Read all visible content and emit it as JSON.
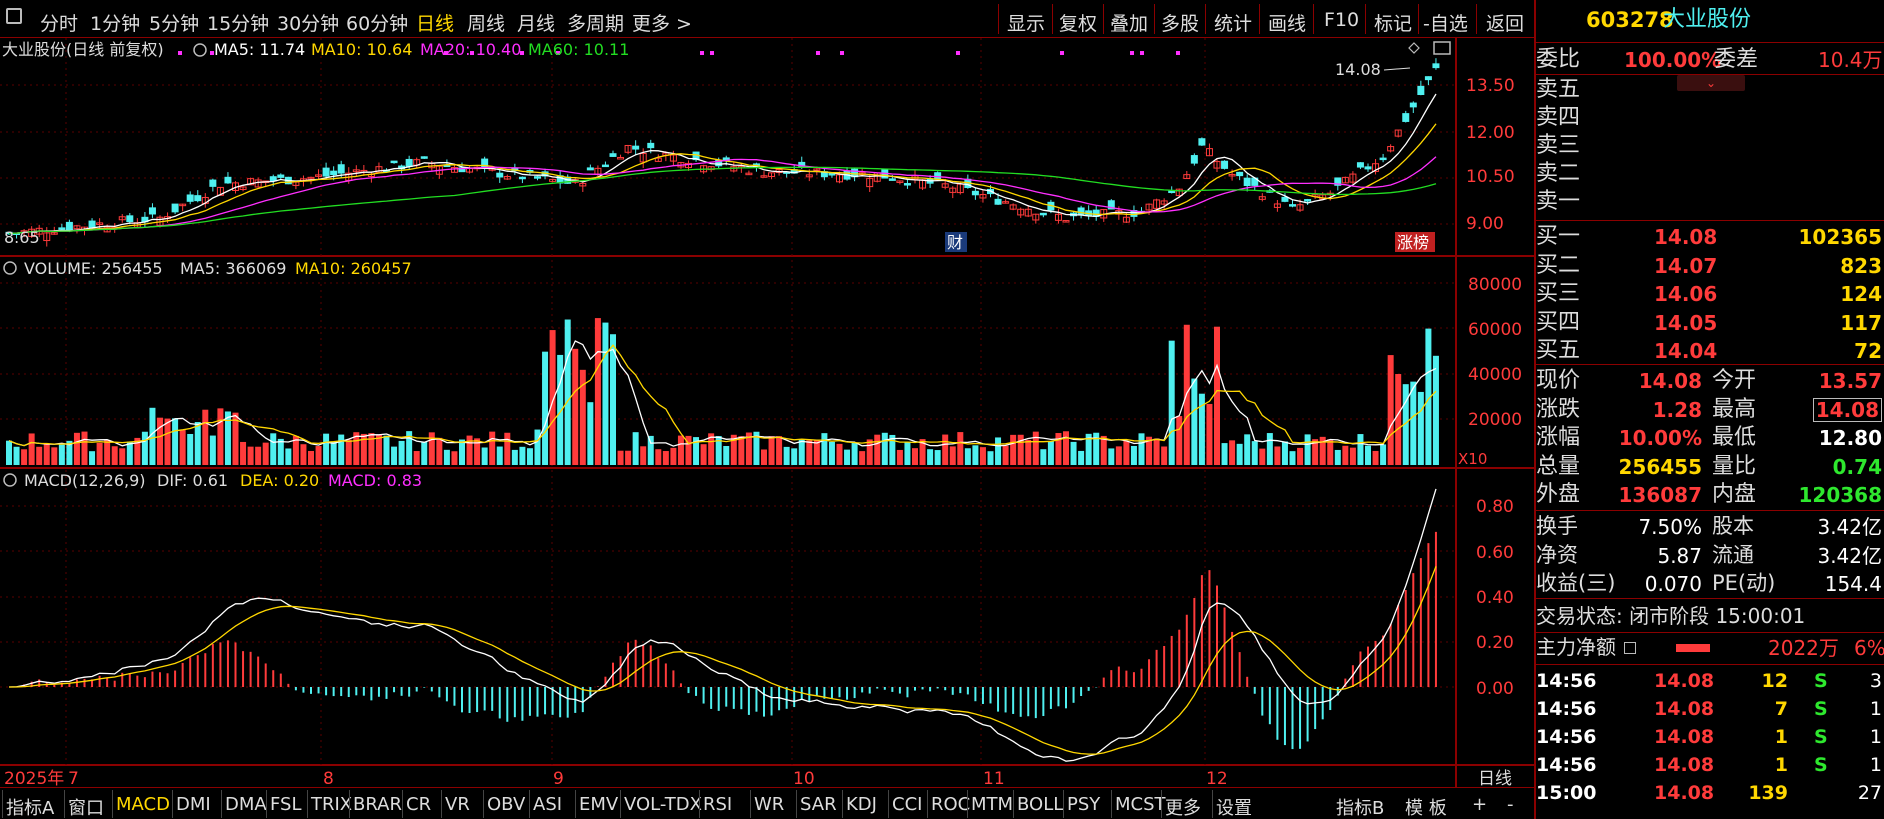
{
  "toolbar": {
    "left_items": [
      "分时",
      "1分钟",
      "5分钟",
      "15分钟",
      "30分钟",
      "60分钟",
      "日线",
      "周线",
      "月线",
      "多周期",
      "更多 >"
    ],
    "active": "日线",
    "right_items": [
      "显示",
      "复权",
      "叠加",
      "多股",
      "统计",
      "画线",
      "F10",
      "标记",
      "-自选",
      "返回"
    ]
  },
  "kline": {
    "title": "大业股份(日线 前复权)",
    "ma5_label": "MA5: 11.74",
    "ma10_label": "MA10: 10.64",
    "ma20_label": "MA20: 10.40",
    "ma60_label": "MA60: 10.11",
    "y_ticks": [
      "13.50",
      "12.00",
      "10.50",
      "9.00"
    ],
    "high_annotation": "14.08",
    "low_annotation": "8.65",
    "badge_cai": "财",
    "badge_zhangbang": "涨榜"
  },
  "volume": {
    "label": "VOLUME: 256455",
    "ma5_label": "MA5: 366069",
    "ma10_label": "MA10: 260457",
    "y_ticks": [
      "80000",
      "60000",
      "40000",
      "20000"
    ],
    "unit": "X10"
  },
  "macd": {
    "label": "MACD(12,26,9)",
    "dif_label": "DIF: 0.61",
    "dea_label": "DEA: 0.20",
    "macd_label": "MACD: 0.83",
    "y_ticks": [
      "0.80",
      "0.60",
      "0.40",
      "0.20",
      "0.00"
    ]
  },
  "date_axis": {
    "labels": [
      "2025年",
      "7",
      "8",
      "9",
      "10",
      "11",
      "12"
    ],
    "period": "日线"
  },
  "bottombar": {
    "items": [
      "指标A",
      "窗口",
      "MACD",
      "DMI",
      "DMA",
      "FSL",
      "TRIX",
      "BRAR",
      "CR",
      "VR",
      "OBV",
      "ASI",
      "EMV",
      "VOL-TDX",
      "RSI",
      "WR",
      "SAR",
      "KDJ",
      "CCI",
      "ROC",
      "MTM",
      "BOLL",
      "PSY",
      "MCST",
      "更多",
      "设置"
    ],
    "right_items": [
      "指标B",
      "模 板",
      "+",
      "-"
    ],
    "active": "MACD"
  },
  "quote": {
    "code": "603278",
    "name": "大业股份",
    "weibi_label": "委比",
    "weibi_value": "100.00%",
    "weicha_label": "委差",
    "weicha_value": "10.4万",
    "sell_labels": [
      "卖五",
      "卖四",
      "卖三",
      "卖二",
      "卖一"
    ],
    "buys": [
      {
        "label": "买一",
        "price": "14.08",
        "vol": "102365"
      },
      {
        "label": "买二",
        "price": "14.07",
        "vol": "823"
      },
      {
        "label": "买三",
        "price": "14.06",
        "vol": "124"
      },
      {
        "label": "买四",
        "price": "14.05",
        "vol": "117"
      },
      {
        "label": "买五",
        "price": "14.04",
        "vol": "72"
      }
    ],
    "stats": [
      {
        "l1": "现价",
        "v1": "14.08",
        "c1": "red",
        "l2": "今开",
        "v2": "13.57",
        "c2": "red"
      },
      {
        "l1": "涨跌",
        "v1": "1.28",
        "c1": "red",
        "l2": "最高",
        "v2": "14.08",
        "c2": "red"
      },
      {
        "l1": "涨幅",
        "v1": "10.00%",
        "c1": "red",
        "l2": "最低",
        "v2": "12.80",
        "c2": "wht"
      },
      {
        "l1": "总量",
        "v1": "256455",
        "c1": "yel",
        "l2": "量比",
        "v2": "0.74",
        "c2": "grn"
      },
      {
        "l1": "外盘",
        "v1": "136087",
        "c1": "red",
        "l2": "内盘",
        "v2": "120368",
        "c2": "grn"
      }
    ],
    "stats2": [
      {
        "l1": "换手",
        "v1": "7.50%",
        "l2": "股本",
        "v2": "3.42亿"
      },
      {
        "l1": "净资",
        "v1": "5.87",
        "l2": "流通",
        "v2": "3.42亿"
      },
      {
        "l1": "收益(三)",
        "v1": "0.070",
        "l2": "PE(动)",
        "v2": "154.4"
      }
    ],
    "trade_status": "交易状态: 闭市阶段 15:00:01",
    "main_net_label": "主力净额",
    "main_net_value": "2022万",
    "main_net_pct": "6%",
    "ticks": [
      {
        "time": "14:56",
        "price": "14.08",
        "vol": "12",
        "bs": "S",
        "n": "3"
      },
      {
        "time": "14:56",
        "price": "14.08",
        "vol": "7",
        "bs": "S",
        "n": "1"
      },
      {
        "time": "14:56",
        "price": "14.08",
        "vol": "1",
        "bs": "S",
        "n": "1"
      },
      {
        "time": "14:56",
        "price": "14.08",
        "vol": "1",
        "bs": "S",
        "n": "1"
      },
      {
        "time": "15:00",
        "price": "14.08",
        "vol": "139",
        "bs": "",
        "n": "27"
      }
    ]
  },
  "colors": {
    "up": "#ff3b3b",
    "down": "#4ff0f0",
    "ma5": "#ffffff",
    "ma10": "#ffd700",
    "ma20": "#ff2fff",
    "ma60": "#22dd22",
    "grid": "#8b0000"
  }
}
